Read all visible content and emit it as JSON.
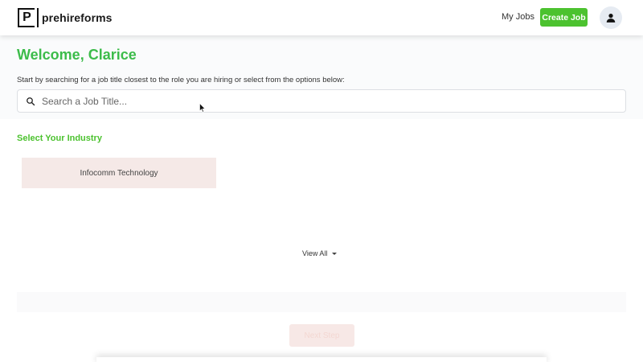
{
  "header": {
    "logo_letter": "P",
    "logo_text": "prehireforms",
    "nav_my_jobs": "My Jobs",
    "create_job_label": "Create Job",
    "avatar_icon": "user-icon"
  },
  "main": {
    "welcome": "Welcome, Clarice",
    "subtitle": "Start by searching for a job title closest to the role you are hiring or select from the options below:",
    "search": {
      "placeholder": "Search a Job Title...",
      "value": "",
      "icon": "search-icon"
    },
    "industry_heading": "Select Your Industry",
    "industries": [
      {
        "label": "Infocomm Technology"
      }
    ],
    "view_all_label": "View All",
    "next_step_label": "Next Step"
  },
  "colors": {
    "brand_green": "#4cc22f",
    "welcome_green": "#3cbc4a",
    "card_bg": "#f5e9e7",
    "disabled_btn_bg": "#f7e8e6"
  }
}
